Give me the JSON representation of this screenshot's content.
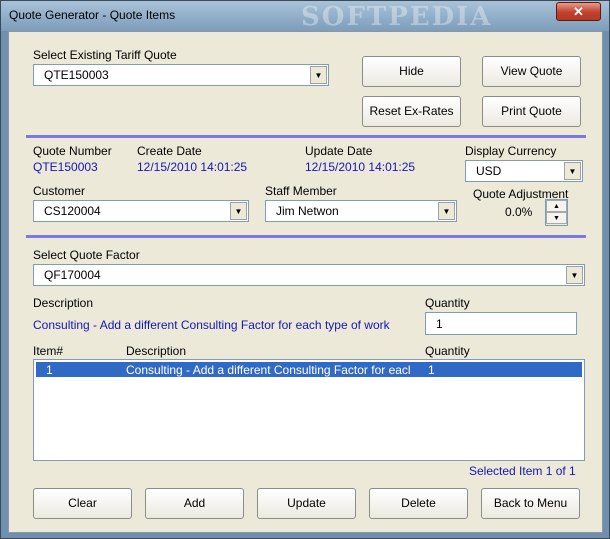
{
  "window": {
    "title": "Quote Generator - Quote Items",
    "watermark": "SOFTPEDIA",
    "close_glyph": "✕"
  },
  "tariff": {
    "label": "Select Existing Tariff Quote",
    "value": "QTE150003"
  },
  "top_buttons": {
    "hide": "Hide",
    "view_quote": "View Quote",
    "reset_ex_rates": "Reset Ex-Rates",
    "print_quote": "Print Quote"
  },
  "quote": {
    "number_label": "Quote Number",
    "number_value": "QTE150003",
    "create_label": "Create Date",
    "create_value": "12/15/2010 14:01:25",
    "update_label": "Update Date",
    "update_value": "12/15/2010 14:01:25",
    "currency_label": "Display Currency",
    "currency_value": "USD",
    "customer_label": "Customer",
    "customer_value": "CS120004",
    "staff_label": "Staff Member",
    "staff_value": "Jim Netwon",
    "adjustment_label": "Quote Adjustment",
    "adjustment_value": "0.0%"
  },
  "factor": {
    "label": "Select Quote Factor",
    "value": "QF170004",
    "description_label": "Description",
    "description_value": "Consulting - Add a different Consulting Factor for each type of work",
    "quantity_label": "Quantity",
    "quantity_value": "1"
  },
  "items_list": {
    "col_item": "Item#",
    "col_description": "Description",
    "col_quantity": "Quantity",
    "rows": [
      {
        "item": "1",
        "description": "Consulting - Add a different Consulting Factor for eacl",
        "quantity": "1"
      }
    ],
    "selected_status": "Selected Item 1 of 1"
  },
  "bottom_buttons": {
    "clear": "Clear",
    "add": "Add",
    "update": "Update",
    "delete": "Delete",
    "back": "Back to Menu"
  },
  "icons": {
    "dropdown_arrow": "▼",
    "spin_up": "▲",
    "spin_down": "▼"
  },
  "colors": {
    "accent_text": "#1515b8",
    "separator": "#7a79e6",
    "selection": "#316ac5"
  }
}
